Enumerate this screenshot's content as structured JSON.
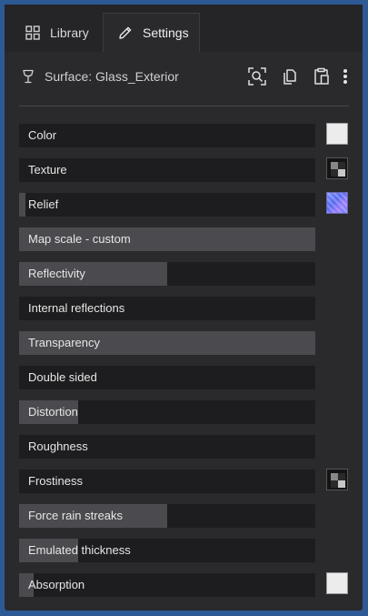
{
  "tabs": {
    "library": {
      "label": "Library",
      "icon": "grid-icon"
    },
    "settings": {
      "label": "Settings",
      "icon": "pencil-icon",
      "active": true
    }
  },
  "header": {
    "surface_label": "Surface: Glass_Exterior",
    "surface_icon": "goblet-icon",
    "actions": [
      "zoom-fit-icon",
      "copy-icon",
      "paste-icon",
      "more-vertical-icon"
    ]
  },
  "colors": {
    "page_bg": "#2d5a94",
    "panel_bg": "#2a2a2d",
    "row_bg": "#1d1d1f",
    "row_fill": "#4b4b4f",
    "text": "#e6e6e6"
  },
  "properties": [
    {
      "label": "Color",
      "level": 0,
      "swatch": "white"
    },
    {
      "label": "Texture",
      "level": 0,
      "swatch": "checker"
    },
    {
      "label": "Relief",
      "level": 0.02,
      "swatch": "normal-map"
    },
    {
      "label": "Map scale - custom",
      "level": 1.0,
      "swatch": null
    },
    {
      "label": "Reflectivity",
      "level": 0.5,
      "swatch": null
    },
    {
      "label": "Internal reflections",
      "level": 0,
      "swatch": null
    },
    {
      "label": "Transparency",
      "level": 1.0,
      "swatch": null
    },
    {
      "label": "Double sided",
      "level": 0,
      "swatch": null
    },
    {
      "label": "Distortion",
      "level": 0.2,
      "swatch": null
    },
    {
      "label": "Roughness",
      "level": 0,
      "swatch": null
    },
    {
      "label": "Frostiness",
      "level": 0,
      "swatch": "checker"
    },
    {
      "label": "Force rain streaks",
      "level": 0.5,
      "swatch": null
    },
    {
      "label": "Emulated thickness",
      "level": 0.2,
      "swatch": null
    },
    {
      "label": "Absorption",
      "level": 0.05,
      "swatch": "white"
    }
  ]
}
